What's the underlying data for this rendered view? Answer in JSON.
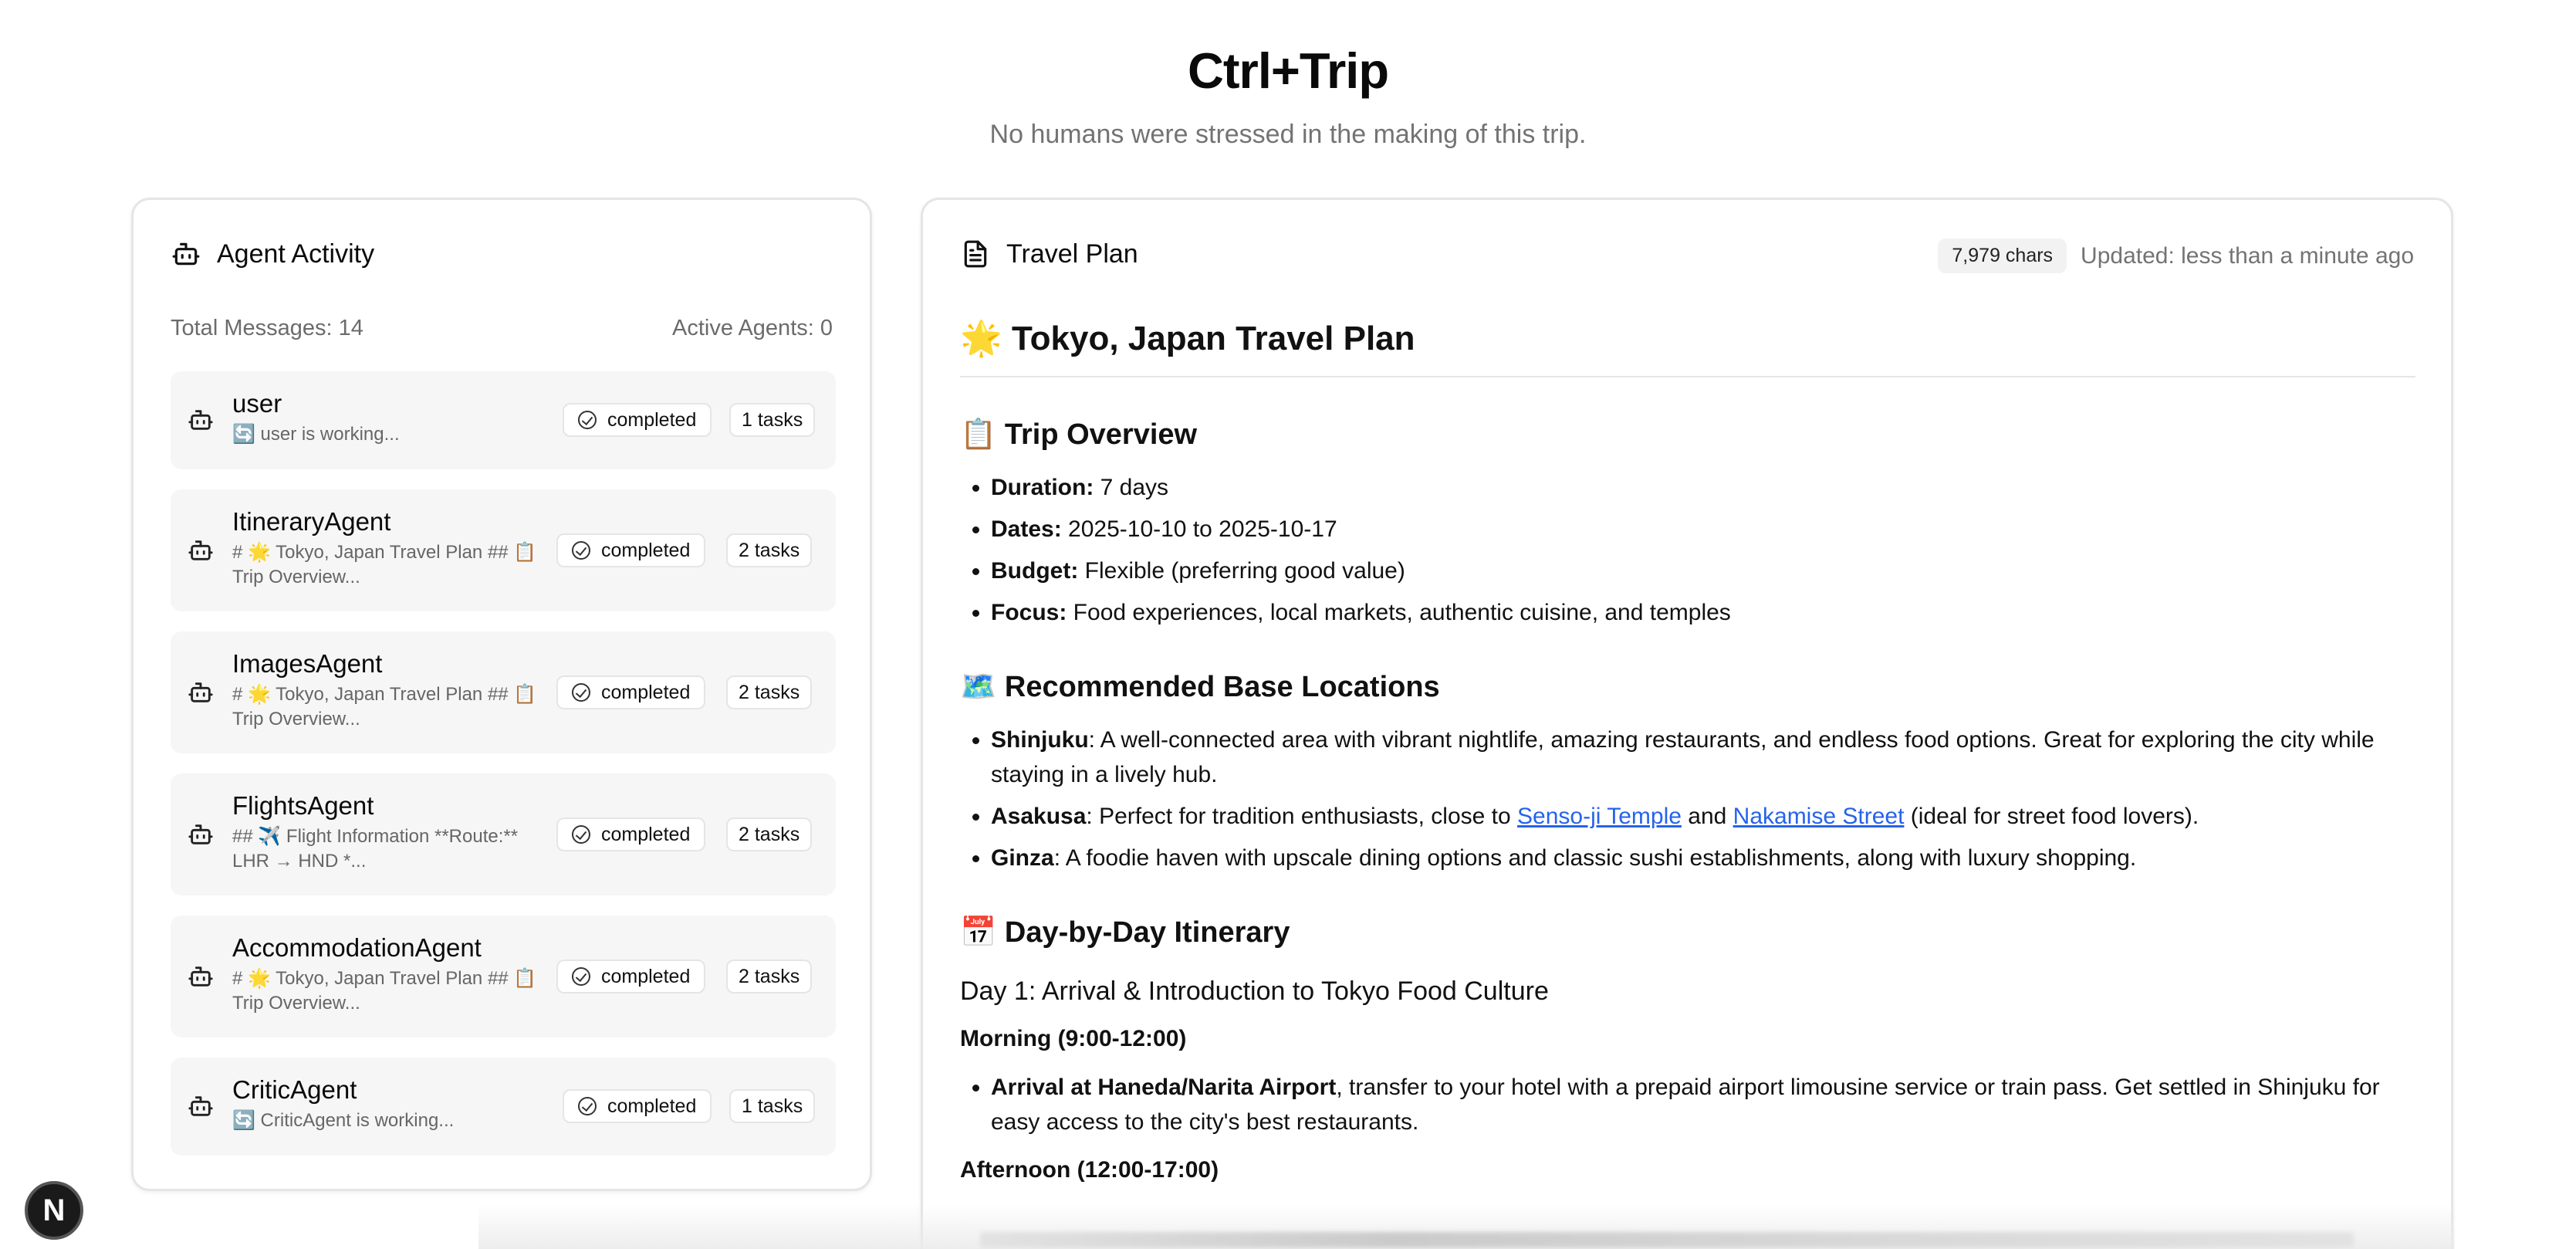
{
  "header": {
    "title": "Ctrl+Trip",
    "subtitle": "No humans were stressed in the making of this trip."
  },
  "agent_panel": {
    "title": "Agent Activity",
    "icon": "bot-icon",
    "total_messages": "Total Messages: 14",
    "active_agents": "Active Agents: 0",
    "agents": [
      {
        "name": "user",
        "desc": "🔄 user is working...",
        "status": "completed",
        "tasks": "1 tasks"
      },
      {
        "name": "ItineraryAgent",
        "desc": "# 🌟 Tokyo, Japan Travel Plan ## 📋 Trip Overview...",
        "status": "completed",
        "tasks": "2 tasks"
      },
      {
        "name": "ImagesAgent",
        "desc": "# 🌟 Tokyo, Japan Travel Plan ## 📋 Trip Overview...",
        "status": "completed",
        "tasks": "2 tasks"
      },
      {
        "name": "FlightsAgent",
        "desc": "## ✈️ Flight Information **Route:** LHR → HND *...",
        "status": "completed",
        "tasks": "2 tasks"
      },
      {
        "name": "AccommodationAgent",
        "desc": "# 🌟 Tokyo, Japan Travel Plan ## 📋 Trip Overview...",
        "status": "completed",
        "tasks": "2 tasks"
      },
      {
        "name": "CriticAgent",
        "desc": "🔄 CriticAgent is working...",
        "status": "completed",
        "tasks": "1 tasks"
      }
    ]
  },
  "plan_panel": {
    "title": "Travel Plan",
    "icon": "document-icon",
    "chars": "7,979 chars",
    "updated": "Updated: less than a minute ago",
    "h1": "🌟 Tokyo, Japan Travel Plan",
    "overview_title": "📋 Trip Overview",
    "overview": [
      {
        "label": "Duration:",
        "text": " 7 days"
      },
      {
        "label": "Dates:",
        "text": " 2025-10-10 to 2025-10-17"
      },
      {
        "label": "Budget:",
        "text": " Flexible (preferring good value)"
      },
      {
        "label": "Focus:",
        "text": " Food experiences, local markets, authentic cuisine, and temples"
      }
    ],
    "locations_title": "🗺️ Recommended Base Locations",
    "locations": {
      "shinjuku_label": "Shinjuku",
      "shinjuku_text": ": A well-connected area with vibrant nightlife, amazing restaurants, and endless food options. Great for exploring the city while staying in a lively hub.",
      "asakusa_label": "Asakusa",
      "asakusa_text1": ": Perfect for tradition enthusiasts, close to ",
      "asakusa_link1": "Senso-ji Temple",
      "asakusa_text2": " and ",
      "asakusa_link2": "Nakamise Street",
      "asakusa_text3": " (ideal for street food lovers).",
      "ginza_label": "Ginza",
      "ginza_text": ": A foodie haven with upscale dining options and classic sushi establishments, along with luxury shopping."
    },
    "itinerary_title": "📅 Day-by-Day Itinerary",
    "day1_title": "Day 1: Arrival & Introduction to Tokyo Food Culture",
    "morning_title": "Morning (9:00-12:00)",
    "morning_label": "Arrival at Haneda/Narita Airport",
    "morning_text": ", transfer to your hotel with a prepaid airport limousine service or train pass. Get settled in Shinjuku for easy access to the city's best restaurants.",
    "afternoon_title": "Afternoon (12:00-17:00)"
  },
  "framework_badge": "N"
}
